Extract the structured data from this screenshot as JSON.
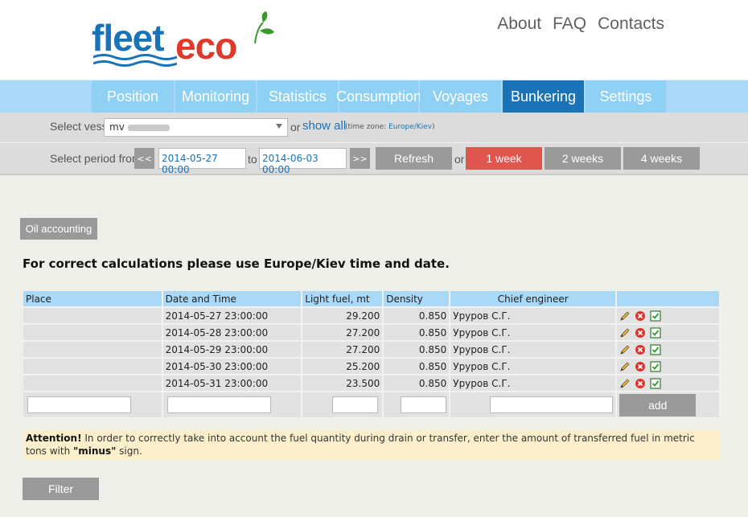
{
  "header": {
    "logo_part1": "fleet",
    "logo_part2": "eco",
    "links": [
      "About",
      "FAQ",
      "Contacts"
    ]
  },
  "nav": {
    "items": [
      "Position",
      "Monitoring",
      "Statistics",
      "Consumption",
      "Voyages",
      "Bunkering",
      "Settings"
    ],
    "active": "Bunkering"
  },
  "vessel": {
    "label": "Select vessel",
    "value": "mv",
    "or": "or",
    "show_all": "show all",
    "tz_prefix": "(time zone:",
    "tz_value": "Europe/Kiev",
    "tz_suffix": ")"
  },
  "period": {
    "label": "Select period from",
    "prev": "<<",
    "from": "2014-05-27 00:00",
    "to_label": "to",
    "to": "2014-06-03 00:00",
    "next": ">>",
    "refresh": "Refresh",
    "or": "or",
    "week1": "1 week",
    "week2": "2 weeks",
    "week4": "4 weeks"
  },
  "oil_accounting": "Oil accounting",
  "notice": "For correct calculations please use Europe/Kiev time and date.",
  "table": {
    "headers": [
      "Place",
      "Date and Time",
      "Light fuel, mt",
      "Density",
      "Chief engineer",
      ""
    ],
    "rows": [
      {
        "place": "",
        "datetime": "2014-05-27 23:00:00",
        "fuel": "29.200",
        "density": "0.850",
        "engineer": "Уруров С.Г."
      },
      {
        "place": "",
        "datetime": "2014-05-28 23:00:00",
        "fuel": "27.200",
        "density": "0.850",
        "engineer": "Уруров С.Г."
      },
      {
        "place": "",
        "datetime": "2014-05-29 23:00:00",
        "fuel": "27.200",
        "density": "0.850",
        "engineer": "Уруров С.Г."
      },
      {
        "place": "",
        "datetime": "2014-05-30 23:00:00",
        "fuel": "25.200",
        "density": "0.850",
        "engineer": "Уруров С.Г."
      },
      {
        "place": "",
        "datetime": "2014-05-31 23:00:00",
        "fuel": "23.500",
        "density": "0.850",
        "engineer": "Уруров С.Г."
      }
    ],
    "add": "add"
  },
  "attention": {
    "strong": "Attention!",
    "text": " In order to correctly take into account the fuel quantity during drain or transfer, enter the amount of transferred fuel in metric tons with ",
    "minus": "\"minus\"",
    "tail": " sign."
  },
  "filter": "Filter",
  "colors": {
    "brand_blue": "#1a73b7",
    "brand_red": "#e0392b",
    "nav_bg": "#8fd1f5",
    "nav_active": "#1a73b7",
    "button_grey": "#9a9a9a",
    "button_red": "#e0554d",
    "attention_bg": "#fbf0cb"
  },
  "icons": [
    "edit-pencil-icon",
    "delete-icon",
    "confirm-checkbox-icon"
  ]
}
